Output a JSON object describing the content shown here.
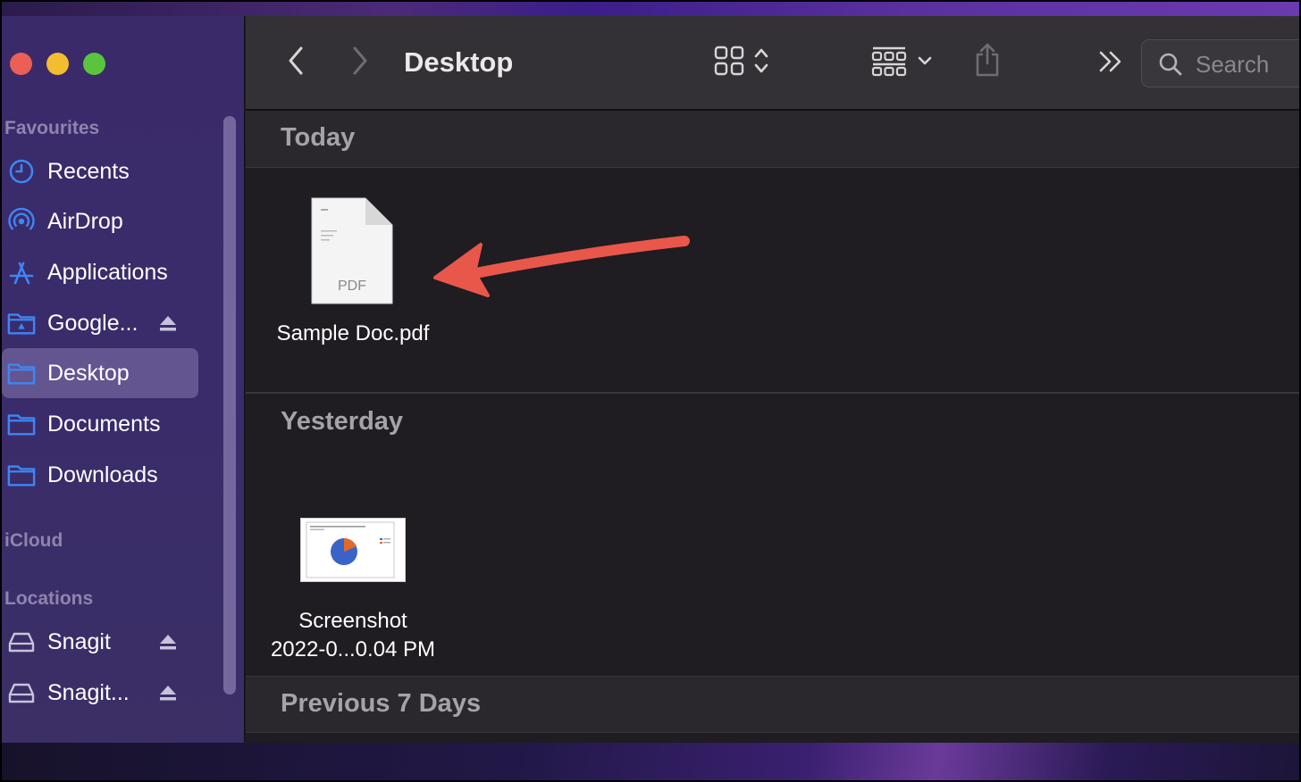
{
  "window": {
    "title": "Desktop"
  },
  "sidebar": {
    "sections": [
      {
        "label": "Favourites"
      },
      {
        "label": "iCloud"
      },
      {
        "label": "Locations"
      }
    ],
    "favourites": [
      {
        "label": "Recents",
        "icon": "clock-icon"
      },
      {
        "label": "AirDrop",
        "icon": "airdrop-icon"
      },
      {
        "label": "Applications",
        "icon": "applications-icon"
      },
      {
        "label": "Google...",
        "icon": "google-drive-folder-icon",
        "ejectable": true
      },
      {
        "label": "Desktop",
        "icon": "folder-icon",
        "selected": true
      },
      {
        "label": "Documents",
        "icon": "folder-icon"
      },
      {
        "label": "Downloads",
        "icon": "folder-icon"
      }
    ],
    "locations": [
      {
        "label": "Snagit",
        "icon": "drive-icon",
        "ejectable": true
      },
      {
        "label": "Snagit...",
        "icon": "drive-icon",
        "ejectable": true
      }
    ]
  },
  "toolbar": {
    "back_icon": "chevron-left-icon",
    "forward_icon": "chevron-right-icon",
    "view_icon": "icon-grid-view-icon",
    "group_icon": "group-by-icon",
    "share_icon": "share-icon",
    "more_icon": "double-chevron-right-icon",
    "search_placeholder": "Search"
  },
  "content": {
    "groups": [
      {
        "header": "Today",
        "files": [
          {
            "name": "Sample Doc.pdf",
            "type_label": "PDF"
          }
        ]
      },
      {
        "header": "Yesterday",
        "files": [
          {
            "name_line1": "Screenshot",
            "name_line2": "2022-0...0.04 PM"
          }
        ]
      },
      {
        "header": "Previous 7 Days",
        "files": []
      }
    ]
  },
  "annotation": {
    "arrow_color": "#e8574a"
  },
  "colors": {
    "accent": "#3d86f5",
    "sidebar_bg": "#3b2c6a",
    "content_bg": "#1f1c22",
    "toolbar_bg": "#343136"
  }
}
